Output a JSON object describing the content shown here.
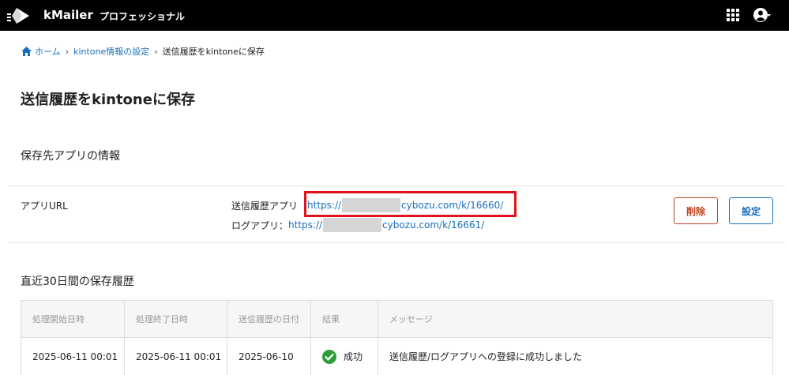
{
  "app": {
    "brand": "kMailer",
    "edition": "プロフェッショナル"
  },
  "breadcrumb": {
    "home": "ホーム",
    "parent": "kintone情報の設定",
    "current": "送信履歴をkintoneに保存"
  },
  "page_title": "送信履歴をkintoneに保存",
  "app_info": {
    "section_title": "保存先アプリの情報",
    "row_label": "アプリURL",
    "history_app": {
      "label": "送信履歴アプリ",
      "url_prefix": "https://",
      "url_suffix": "cybozu.com/k/16660/"
    },
    "log_app": {
      "label": "ログアプリ：",
      "url_prefix": "https://",
      "url_suffix": "cybozu.com/k/16661/"
    },
    "delete_label": "削除",
    "settings_label": "設定"
  },
  "history": {
    "section_title": "直近30日間の保存履歴",
    "columns": [
      "処理開始日時",
      "処理終了日時",
      "送信履歴の日付",
      "結果",
      "メッセージ"
    ],
    "rows": [
      {
        "start": "2025-06-11 00:01",
        "end": "2025-06-11 00:01",
        "date": "2025-06-10",
        "result": "成功",
        "message": "送信履歴/ログアプリへの登録に成功しました"
      }
    ]
  },
  "colors": {
    "topbar": "#000000",
    "link": "#1a6fbf",
    "delete": "#c0431f",
    "success": "#2e9e3a",
    "highlight": "#e0141c"
  },
  "icons": [
    "kmailer-logo-icon",
    "apps-grid-icon",
    "user-account-icon",
    "home-icon",
    "chevron-right-icon",
    "success-check-icon"
  ]
}
